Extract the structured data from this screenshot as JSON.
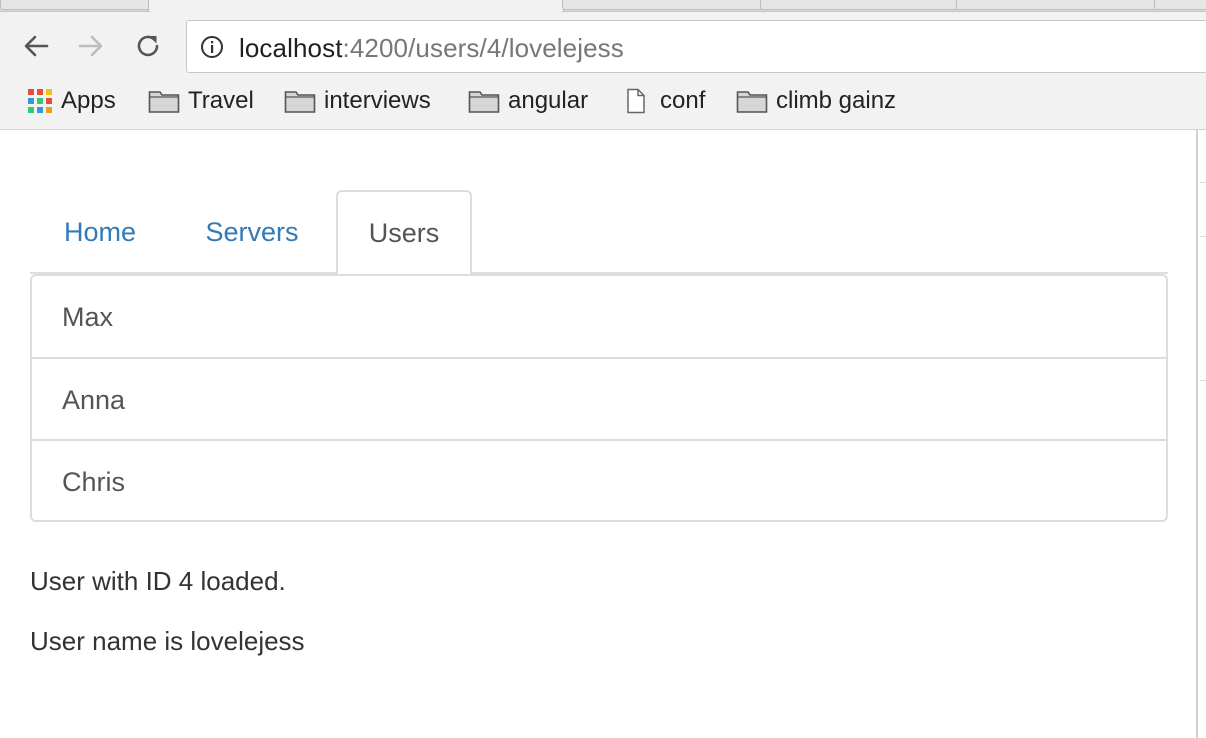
{
  "browser": {
    "url_host": "localhost",
    "url_path": ":4200/users/4/lovelejess",
    "bookmarks": [
      {
        "label": "Apps",
        "icon": "apps-grid-icon"
      },
      {
        "label": "Travel",
        "icon": "folder-icon"
      },
      {
        "label": "interviews",
        "icon": "folder-icon"
      },
      {
        "label": "angular",
        "icon": "folder-icon"
      },
      {
        "label": "conf",
        "icon": "document-icon"
      },
      {
        "label": "climb gainz",
        "icon": "folder-icon"
      }
    ]
  },
  "nav": {
    "tabs": [
      {
        "label": "Home",
        "active": false
      },
      {
        "label": "Servers",
        "active": false
      },
      {
        "label": "Users",
        "active": true
      }
    ]
  },
  "users": {
    "items": [
      "Max",
      "Anna",
      "Chris"
    ]
  },
  "user_detail": {
    "loaded_text": "User with ID 4 loaded.",
    "name_text": "User name is lovelejess"
  },
  "colors": {
    "link": "#337ab7",
    "active_tab_text": "#555555",
    "border": "#dddddd"
  }
}
